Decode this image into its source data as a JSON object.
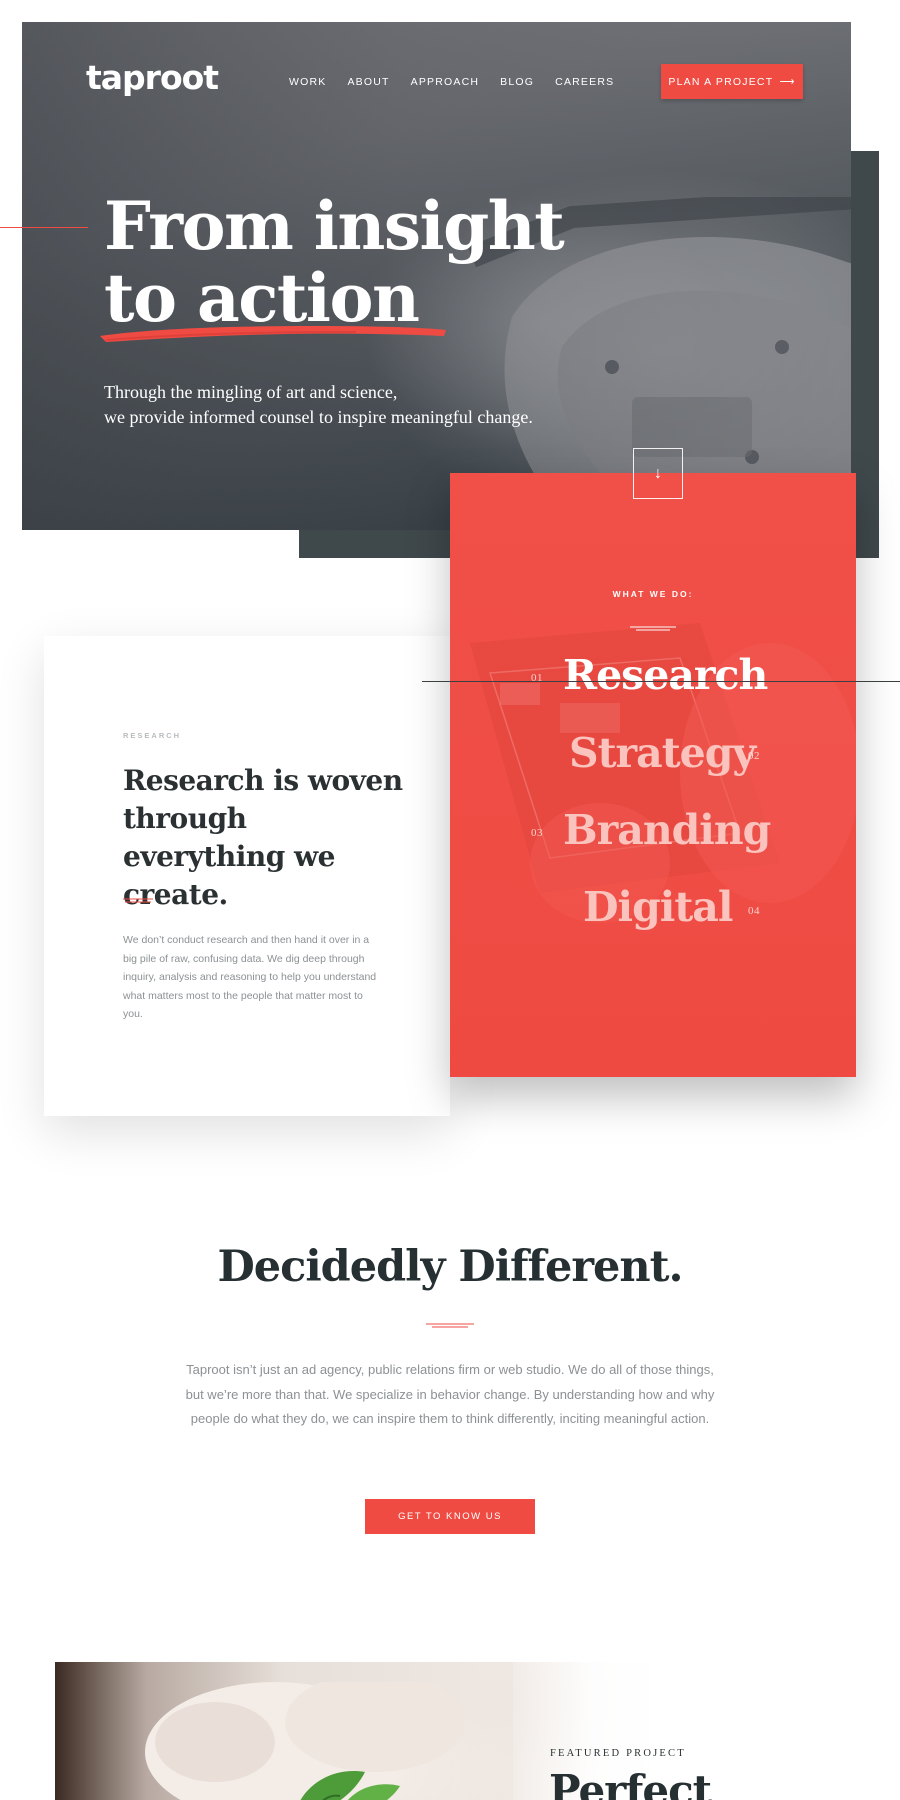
{
  "brand": {
    "logo_text": "taproot",
    "accent_color": "#ef4b43",
    "dark_color": "#3f484b"
  },
  "nav": {
    "items": [
      "WORK",
      "ABOUT",
      "APPROACH",
      "BLOG",
      "CAREERS"
    ],
    "cta_label": "PLAN A PROJECT",
    "cta_icon": "arrow-right-icon"
  },
  "hero": {
    "title_line1": "From insight",
    "title_line2": "to action",
    "subtitle_line1": "Through the mingling of art and science,",
    "subtitle_line2": "we provide informed counsel to inspire meaningful change.",
    "scroll_icon": "arrow-down-icon"
  },
  "services": {
    "heading": "WHAT WE DO:",
    "items": [
      {
        "num": "01",
        "label": "Research",
        "active": true
      },
      {
        "num": "02",
        "label": "Strategy",
        "active": false
      },
      {
        "num": "03",
        "label": "Branding",
        "active": false
      },
      {
        "num": "04",
        "label": "Digital",
        "active": false
      }
    ]
  },
  "research_card": {
    "label": "RESEARCH",
    "title": "Research is woven through everything we create.",
    "body": "We don’t conduct research and then hand it over in a big pile of raw, confusing data. We dig deep through inquiry, analysis and reasoning to help you understand what matters most to the people that matter most to you."
  },
  "different": {
    "title": "Decidedly Different.",
    "body": "Taproot isn’t just an ad agency, public relations firm or web studio. We do all of those things, but we’re more than that. We specialize in behavior change. By understanding how and why people do what they do, we can inspire them to think differently, inciting meaningful action.",
    "cta_label": "GET TO KNOW US"
  },
  "featured": {
    "label": "FEATURED PROJECT",
    "title": "Perfect"
  }
}
